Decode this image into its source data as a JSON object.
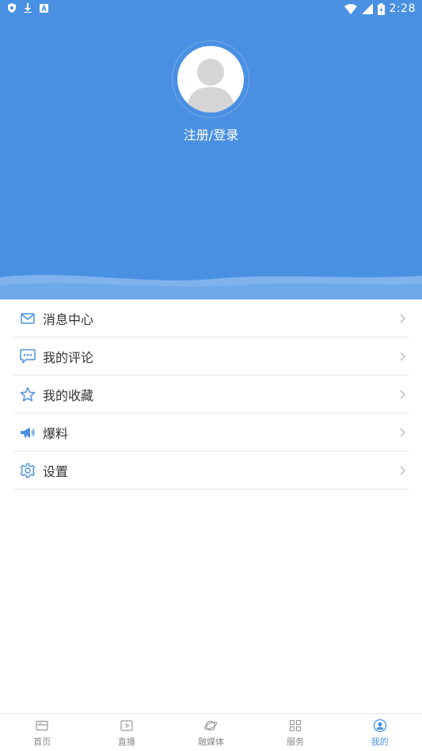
{
  "colors": {
    "primary": "#4a90e2",
    "text": "#333333",
    "muted": "#888888",
    "divider": "#e6e6e6"
  },
  "status_bar": {
    "time": "2:28",
    "icons_left": [
      "shield-icon",
      "download-icon",
      "app-a-icon"
    ],
    "icons_right": [
      "wifi-icon",
      "signal-icon",
      "battery-icon"
    ]
  },
  "profile": {
    "login_label": "注册/登录"
  },
  "menu": {
    "items": [
      {
        "label": "消息中心",
        "icon": "mail-icon"
      },
      {
        "label": "我的评论",
        "icon": "comment-icon"
      },
      {
        "label": "我的收藏",
        "icon": "star-icon"
      },
      {
        "label": "爆料",
        "icon": "megaphone-icon"
      },
      {
        "label": "设置",
        "icon": "gear-icon"
      }
    ]
  },
  "bottom_nav": {
    "items": [
      {
        "label": "首页",
        "icon": "home-card-icon",
        "active": false
      },
      {
        "label": "直播",
        "icon": "play-icon",
        "active": false
      },
      {
        "label": "融媒体",
        "icon": "planet-icon",
        "active": false
      },
      {
        "label": "服务",
        "icon": "grid-icon",
        "active": false
      },
      {
        "label": "我的",
        "icon": "user-icon",
        "active": true
      }
    ]
  }
}
